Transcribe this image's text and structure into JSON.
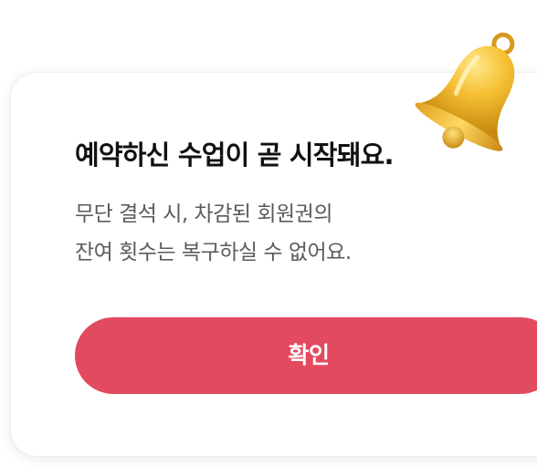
{
  "dialog": {
    "title": "예약하신 수업이 곧 시작돼요.",
    "message_lines": [
      "무단 결석 시, 차감된 회원권의",
      "잔여 횟수는 복구하실 수 없어요."
    ],
    "confirm_label": "확인"
  },
  "icons": {
    "bell": "bell-icon"
  },
  "colors": {
    "accent": "#e24a60",
    "title_text": "#111111",
    "body_text": "#5b5b5b",
    "bell_gold": "#f2b52a"
  }
}
